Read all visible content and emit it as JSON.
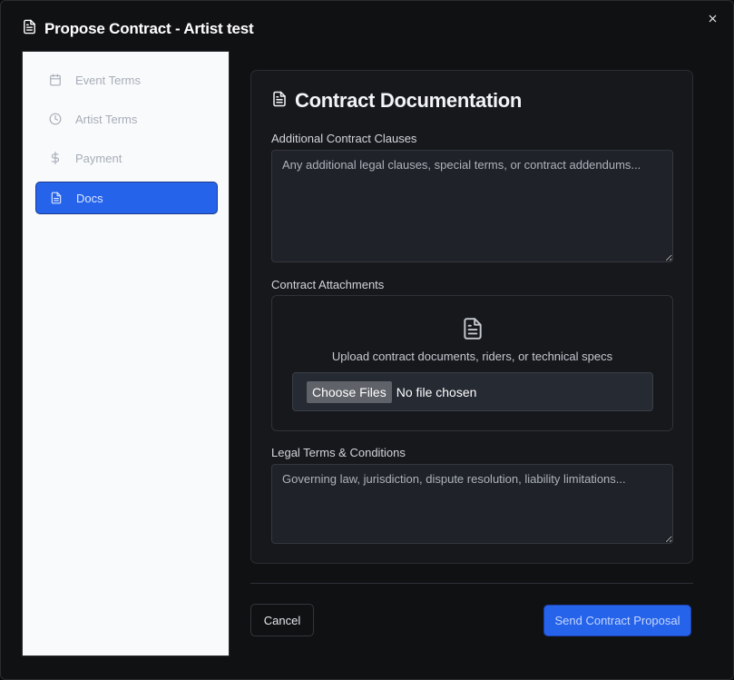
{
  "modal": {
    "title": "Propose Contract - Artist test",
    "title_icon": "document-icon",
    "close_icon": "close-icon"
  },
  "sidebar": {
    "items": [
      {
        "label": "Event Terms",
        "icon": "calendar-icon",
        "active": false
      },
      {
        "label": "Artist Terms",
        "icon": "clock-icon",
        "active": false
      },
      {
        "label": "Payment",
        "icon": "dollar-icon",
        "active": false
      },
      {
        "label": "Docs",
        "icon": "document-icon",
        "active": true
      }
    ]
  },
  "section": {
    "title": "Contract Documentation",
    "icon": "document-icon"
  },
  "fields": {
    "additional_clauses": {
      "label": "Additional Contract Clauses",
      "placeholder": "Any additional legal clauses, special terms, or contract addendums...",
      "value": ""
    },
    "attachments": {
      "label": "Contract Attachments",
      "upload_text": "Upload contract documents, riders, or technical specs",
      "choose_button": "Choose Files",
      "file_status": "No file chosen"
    },
    "legal_terms": {
      "label": "Legal Terms & Conditions",
      "placeholder": "Governing law, jurisdiction, dispute resolution, liability limitations...",
      "value": ""
    }
  },
  "footer": {
    "cancel_label": "Cancel",
    "submit_label": "Send Contract Proposal"
  },
  "colors": {
    "accent": "#2563eb",
    "background": "#101113",
    "card": "#17181c",
    "sidebar": "#f8fafc"
  }
}
